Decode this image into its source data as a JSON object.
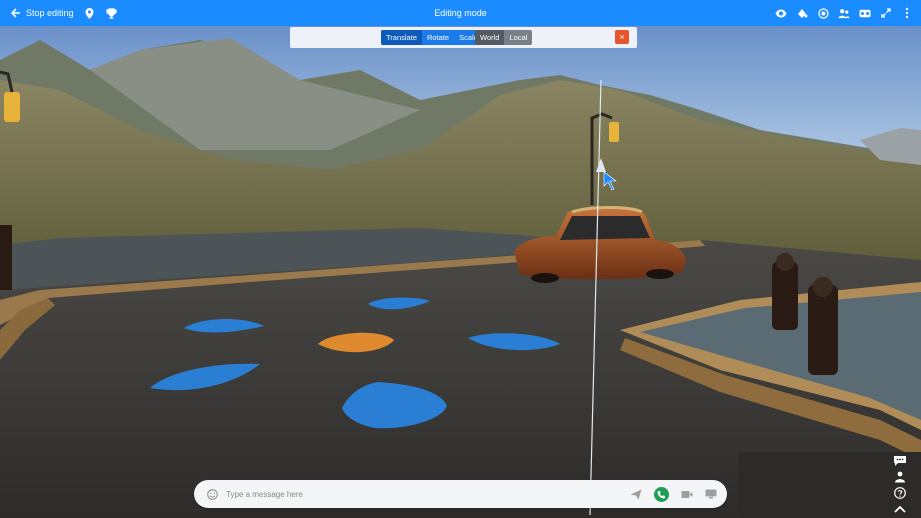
{
  "topbar": {
    "stop_label": "Stop editing",
    "title": "Editing mode",
    "left_icons": [
      "arrow-left-icon",
      "location-pin-icon",
      "trophy-icon"
    ],
    "right_icons": [
      "eye-icon",
      "paint-drop-icon",
      "target-icon",
      "people-icon",
      "vr-headset-icon",
      "expand-icon",
      "more-icon"
    ],
    "color": "#1a8cff"
  },
  "transform_toolbar": {
    "modes": [
      "Translate",
      "Rotate",
      "Scale"
    ],
    "active_mode": "Translate",
    "spaces": [
      "World",
      "Local"
    ],
    "active_space": "World",
    "close_label": "×"
  },
  "message_bar": {
    "placeholder": "Type a message here",
    "icons": [
      "emoji-icon",
      "send-icon",
      "phone-icon",
      "video-icon",
      "screen-share-icon"
    ]
  },
  "side_icons": [
    "chat-icon",
    "users-icon",
    "help-icon",
    "chevron-up-icon"
  ],
  "colors": {
    "accent": "#1a8cff",
    "marker_blue": "#2a7fd4",
    "marker_orange": "#e08a30"
  }
}
